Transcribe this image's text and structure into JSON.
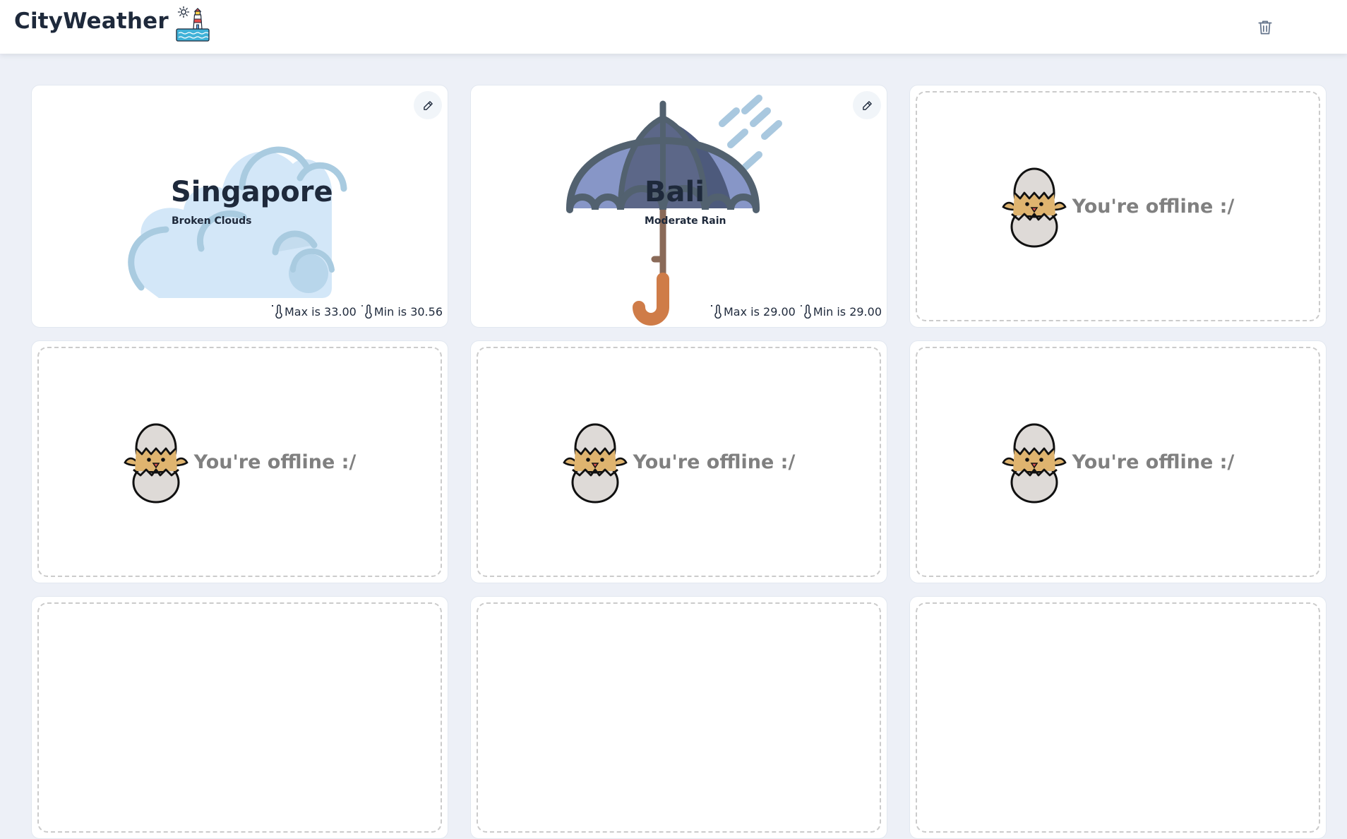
{
  "header": {
    "title": "CityWeather",
    "logo_icon": "lighthouse-sun-icon",
    "clear_icon": "trash-icon"
  },
  "cards": [
    {
      "type": "weather",
      "city": "Singapore",
      "description": "Broken Clouds",
      "max_label": "Max is 33.00",
      "min_label": "Min is 30.56",
      "art_icon": "cloud-icon",
      "edit_icon": "pencil-icon"
    },
    {
      "type": "weather",
      "city": "Bali",
      "description": "Moderate Rain",
      "max_label": "Max is 29.00",
      "min_label": "Min is 29.00",
      "art_icon": "umbrella-rain-icon",
      "edit_icon": "pencil-icon"
    },
    {
      "type": "offline",
      "message": "You're offline :/"
    },
    {
      "type": "offline",
      "message": "You're offline :/"
    },
    {
      "type": "offline",
      "message": "You're offline :/"
    },
    {
      "type": "offline",
      "message": "You're offline :/"
    },
    {
      "type": "offline",
      "message": ""
    },
    {
      "type": "offline",
      "message": ""
    },
    {
      "type": "offline",
      "message": ""
    }
  ],
  "colors": {
    "background": "#edf0f7",
    "card": "#ffffff",
    "text": "#1e293b",
    "offline_text": "#808080",
    "dashed_border": "#cbcbcb"
  }
}
